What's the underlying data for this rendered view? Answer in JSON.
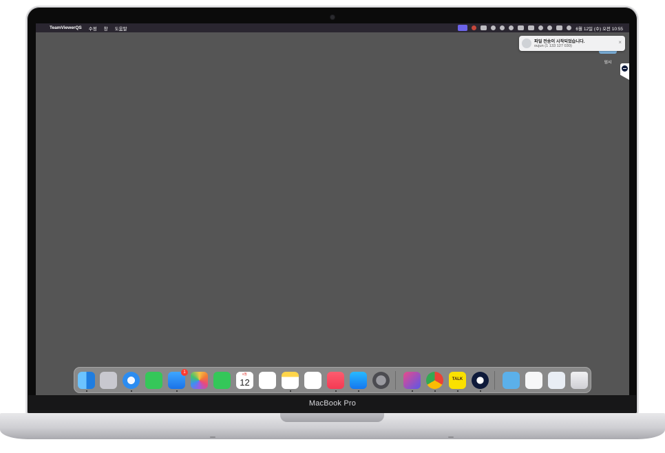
{
  "menubar": {
    "apple": "",
    "app_name": "TeamViewerQS",
    "menus": [
      "수정",
      "창",
      "도움말"
    ],
    "clock": "6월 12일 (수) 오전 10:55"
  },
  "notification": {
    "title": "파일 전송이 시작되었습니다.",
    "subtitle": "oujun (1 133 127 030)",
    "close": "×"
  },
  "desktop": {
    "folder_label": "임시"
  },
  "dock": {
    "mail_badge": "1",
    "calendar_month": "6월",
    "calendar_day": "12",
    "kakaotalk_label": "TALK"
  },
  "device": {
    "model_label": "MacBook Pro"
  },
  "colors": {
    "screen_bg": "#555555",
    "menubar_bg": "#2a2630",
    "accent": "#6b63e8"
  }
}
